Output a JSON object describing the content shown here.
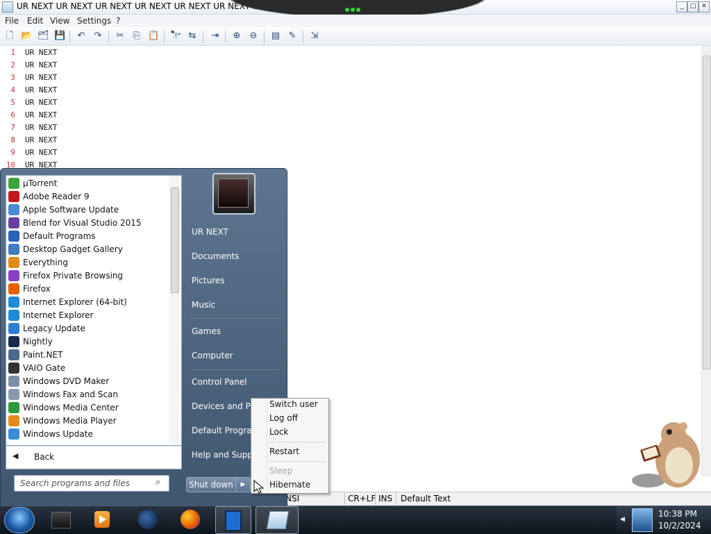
{
  "window": {
    "title": "UR NEXT UR NEXT UR NEXT UR NEXT UR NEXT UR NEXT UR NEXT UR NEXT UR N",
    "buttons": {
      "minimize": "0",
      "maximize": "1",
      "close": "r"
    }
  },
  "menubar": [
    "File",
    "Edit",
    "View",
    "Settings",
    "?"
  ],
  "toolbar": [
    "new-icon",
    "open-icon",
    "open-as-icon",
    "save-icon",
    "undo-icon",
    "redo-icon",
    "cut-icon",
    "copy-icon",
    "paste-icon",
    "find-icon",
    "replace-icon",
    "goto-icon",
    "zoom-in-icon",
    "zoom-out-icon",
    "view-icon",
    "edit-icon",
    "exit-icon"
  ],
  "editor": {
    "lines": [
      {
        "n": "1",
        "text": "UR  NEXT"
      },
      {
        "n": "2",
        "text": "UR  NEXT"
      },
      {
        "n": "3",
        "text": "UR  NEXT"
      },
      {
        "n": "4",
        "text": "UR  NEXT"
      },
      {
        "n": "5",
        "text": "UR  NEXT"
      },
      {
        "n": "6",
        "text": "UR  NEXT"
      },
      {
        "n": "7",
        "text": "UR  NEXT"
      },
      {
        "n": "8",
        "text": "UR  NEXT"
      },
      {
        "n": "9",
        "text": "UR  NEXT"
      },
      {
        "n": "10",
        "text": "UR  NEXT"
      }
    ]
  },
  "statusbar": {
    "encoding": "NSI",
    "eol": "CR+LF",
    "mode": "INS",
    "scheme": "Default Text"
  },
  "startmenu": {
    "programs": [
      {
        "label": "µTorrent",
        "color": "#3aa53a"
      },
      {
        "label": "Adobe Reader 9",
        "color": "#c4161c"
      },
      {
        "label": "Apple Software Update",
        "color": "#4a8bd6"
      },
      {
        "label": "Blend for Visual Studio 2015",
        "color": "#6a3fa0"
      },
      {
        "label": "Default Programs",
        "color": "#2a62b8"
      },
      {
        "label": "Desktop Gadget Gallery",
        "color": "#3f7cc2"
      },
      {
        "label": "Everything",
        "color": "#e08a1a"
      },
      {
        "label": "Firefox Private Browsing",
        "color": "#8b3fc8"
      },
      {
        "label": "Firefox",
        "color": "#e66000"
      },
      {
        "label": "Internet Explorer (64-bit)",
        "color": "#1f8ad6"
      },
      {
        "label": "Internet Explorer",
        "color": "#1f8ad6"
      },
      {
        "label": "Legacy Update",
        "color": "#2f7fd1"
      },
      {
        "label": "Nightly",
        "color": "#1b2a4a"
      },
      {
        "label": "Paint.NET",
        "color": "#4f6a8a"
      },
      {
        "label": "VAIO Gate",
        "color": "#333333"
      },
      {
        "label": "Windows DVD Maker",
        "color": "#7a8ea6"
      },
      {
        "label": "Windows Fax and Scan",
        "color": "#8a9aae"
      },
      {
        "label": "Windows Media Center",
        "color": "#2a9a3a"
      },
      {
        "label": "Windows Media Player",
        "color": "#e48a1a"
      },
      {
        "label": "Windows Update",
        "color": "#3d8bd8"
      }
    ],
    "back": "Back",
    "search_placeholder": "Search programs and files",
    "right_links": [
      "UR NEXT",
      "Documents",
      "Pictures",
      "Music",
      "Games",
      "Computer",
      "Control Panel",
      "Devices and Prin",
      "Default Program",
      "Help and Suppo"
    ],
    "shutdown": "Shut down",
    "power_menu": {
      "switch_user": "Switch user",
      "log_off": "Log off",
      "lock": "Lock",
      "restart": "Restart",
      "sleep": "Sleep",
      "hibernate": "Hibernate"
    }
  },
  "taskbar": {
    "clock_time": "10:38 PM",
    "clock_date": "10/2/2024"
  }
}
